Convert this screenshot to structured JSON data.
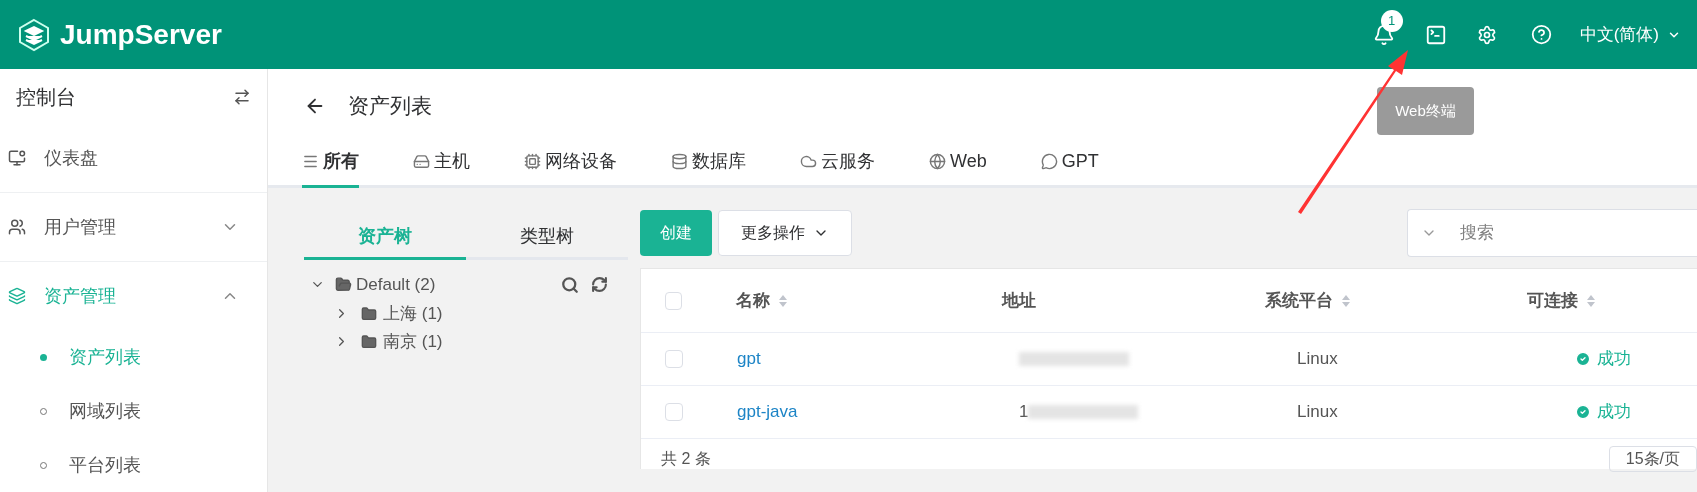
{
  "header": {
    "logo": "JumpServer",
    "notification_count": "1",
    "language": "中文(简体)",
    "tooltip": "Web终端"
  },
  "sidebar": {
    "title": "控制台",
    "items": [
      {
        "label": "仪表盘",
        "selected": false
      },
      {
        "label": "用户管理",
        "expanded": false,
        "selected": false
      },
      {
        "label": "资产管理",
        "expanded": true,
        "selected": true,
        "children": [
          {
            "label": "资产列表",
            "selected": true
          },
          {
            "label": "网域列表",
            "selected": false
          },
          {
            "label": "平台列表",
            "selected": false
          }
        ]
      }
    ]
  },
  "page": {
    "title": "资产列表",
    "tabs": [
      {
        "label": "所有",
        "selected": true
      },
      {
        "label": "主机",
        "selected": false
      },
      {
        "label": "网络设备",
        "selected": false
      },
      {
        "label": "数据库",
        "selected": false
      },
      {
        "label": "云服务",
        "selected": false
      },
      {
        "label": "Web",
        "selected": false
      },
      {
        "label": "GPT",
        "selected": false
      }
    ]
  },
  "tree_panel": {
    "tabs": [
      {
        "label": "资产树",
        "selected": true
      },
      {
        "label": "类型树",
        "selected": false
      }
    ],
    "tree": [
      {
        "label": "Default (2)",
        "expanded": true,
        "children": [
          {
            "label": "上海 (1)",
            "expanded": false
          },
          {
            "label": "南京 (1)",
            "expanded": false
          }
        ]
      }
    ]
  },
  "toolbar": {
    "create": "创建",
    "more": "更多操作",
    "search_placeholder": "搜索"
  },
  "table": {
    "all_checked": false,
    "columns": [
      {
        "label": "名称",
        "sortable": true
      },
      {
        "label": "地址",
        "sortable": false
      },
      {
        "label": "系统平台",
        "sortable": true
      },
      {
        "label": "可连接",
        "sortable": true
      }
    ],
    "rows": [
      {
        "checked": false,
        "name": "gpt",
        "address": "",
        "platform": "Linux",
        "status": "成功"
      },
      {
        "checked": false,
        "name": "gpt-java",
        "address": "1",
        "platform": "Linux",
        "status": "成功"
      }
    ]
  },
  "pagination": {
    "total": "共 2 条",
    "page_size": "15条/页"
  }
}
